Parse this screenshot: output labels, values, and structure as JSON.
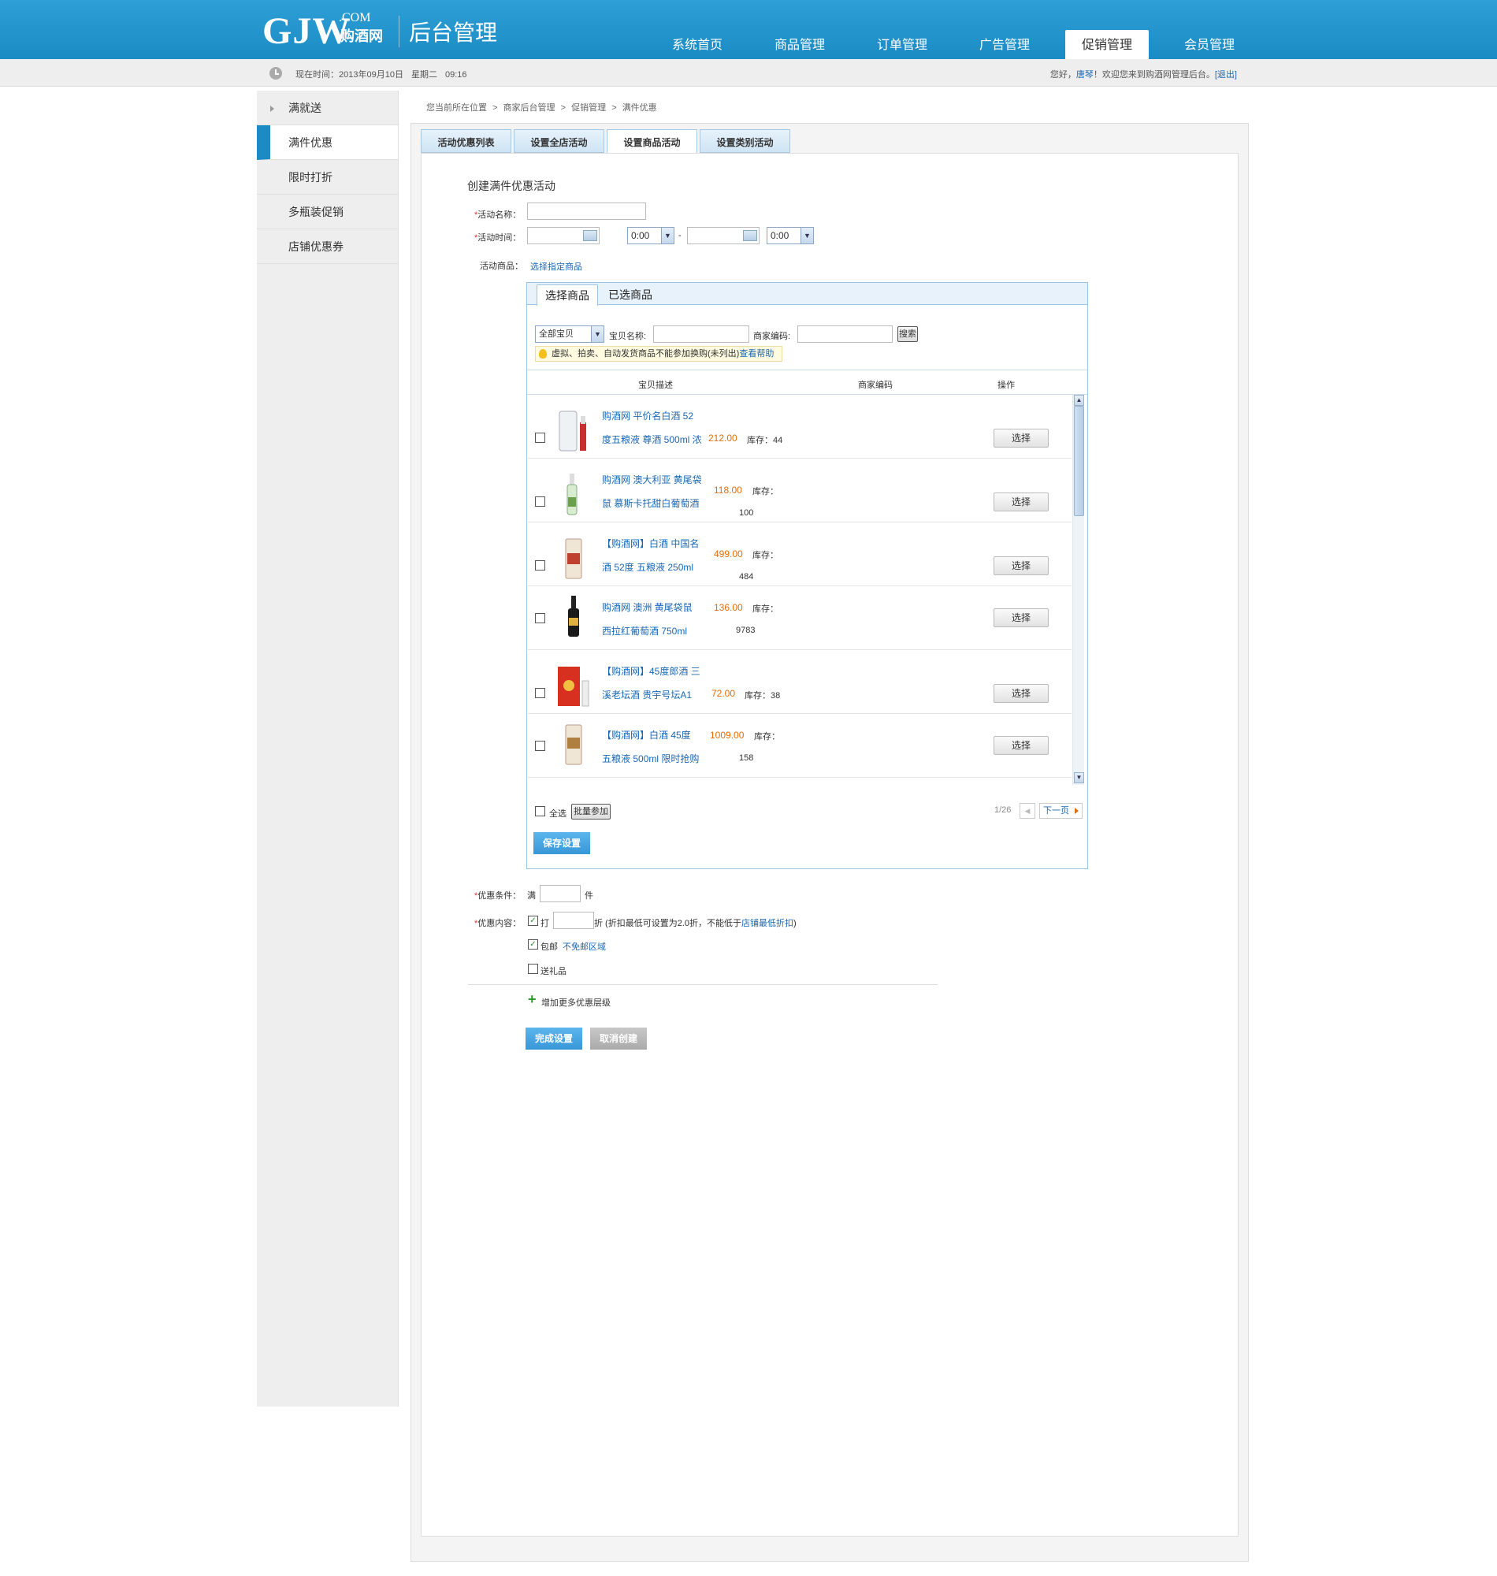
{
  "header": {
    "logo_text": "GJW",
    "logo_com": ".COM",
    "logo_cn": "购酒网",
    "admin_title": "后台管理",
    "nav": [
      "系统首页",
      "商品管理",
      "订单管理",
      "广告管理",
      "促销管理",
      "会员管理"
    ],
    "active_nav": "促销管理"
  },
  "status_bar": {
    "time_label": "现在时间：",
    "date": "2013年09月10日",
    "weekday": "星期二",
    "time": "09:16",
    "greeting": "您好，",
    "user": "唐琴",
    "welcome_text": "！欢迎您来到购酒网管理后台。",
    "logout": "[退出]"
  },
  "sidebar": {
    "items": [
      "满就送",
      "满件优惠",
      "限时打折",
      "多瓶装促销",
      "店铺优惠券"
    ],
    "active": "满件优惠"
  },
  "breadcrumb": [
    "您当前所在位置",
    ">",
    "商家后台管理",
    ">",
    "促销管理",
    ">",
    "满件优惠"
  ],
  "tabs": [
    "活动优惠列表",
    "设置全店活动",
    "设置商品活动",
    "设置类别活动"
  ],
  "active_tab": "设置商品活动",
  "form": {
    "title": "创建满件优惠活动",
    "required_mark": "*",
    "name_label": "活动名称：",
    "name_value": "",
    "time_label": "活动时间：",
    "start_date": "",
    "start_time": "0:00",
    "dash": "-",
    "end_date": "",
    "end_time": "0:00",
    "goods_label": "活动商品：",
    "goods_link": "选择指定商品"
  },
  "selector": {
    "tabs": [
      "选择商品",
      "已选商品"
    ],
    "category": "全部宝贝",
    "name_label": "宝贝名称:",
    "name_value": "",
    "code_label": "商家编码:",
    "code_value": "",
    "search_btn": "搜索",
    "tip": "虚拟、拍卖、自动发货商品不能参加换购(未列出)",
    "tip_link": "查看帮助",
    "columns": [
      "宝贝描述",
      "商家编码",
      "操作"
    ],
    "stock_label": "库存：",
    "select_btn": "选择",
    "items": [
      {
        "line1": "购酒网 平价名白酒 52",
        "line2": "度五粮液 尊酒 500ml 浓",
        "price": "212.00",
        "stock": "44"
      },
      {
        "line1": "购酒网 澳大利亚 黄尾袋",
        "line2": "鼠 慕斯卡托甜白葡萄酒",
        "price": "118.00",
        "stock": "100"
      },
      {
        "line1": "【购酒网】白酒 中国名",
        "line2": "酒 52度 五粮液 250ml",
        "price": "499.00",
        "stock": "484"
      },
      {
        "line1": "购酒网 澳洲 黄尾袋鼠",
        "line2": "西拉红葡萄酒 750ml",
        "price": "136.00",
        "stock": "9783"
      },
      {
        "line1": "【购酒网】45度郎酒 三",
        "line2": "溪老坛酒 贵宇号坛A1",
        "price": "72.00",
        "stock": "38"
      },
      {
        "line1": "【购酒网】白酒 45度",
        "line2": "五粮液 500ml 限时抢购",
        "price": "1009.00",
        "stock": "158"
      }
    ],
    "select_all": "全选",
    "batch_btn": "批量参加",
    "page_info": "1/26",
    "prev": "◀",
    "next": "下一页",
    "save_btn": "保存设置"
  },
  "discount": {
    "condition_label": "优惠条件：",
    "condition_prefix": "满",
    "condition_value": "",
    "condition_unit": "件",
    "content_label": "优惠内容：",
    "discount_checked": true,
    "discount_text": "打",
    "discount_value": "",
    "discount_note_prefix": "折 (折扣最低可设置为2.0折，不能低于",
    "discount_note_link": "店铺最低折扣",
    "discount_note_suffix": ")",
    "shipping_checked": true,
    "shipping_text": "包邮",
    "shipping_link": "不免邮区域",
    "gift_checked": false,
    "gift_text": "送礼品",
    "add_level": "增加更多优惠层级",
    "finish_btn": "完成设置",
    "cancel_btn": "取消创建"
  },
  "colors": {
    "header_blue": "#1a8bc4",
    "link_blue": "#1b67b3",
    "price_orange": "#e36c0a",
    "required_red": "#e03030"
  }
}
